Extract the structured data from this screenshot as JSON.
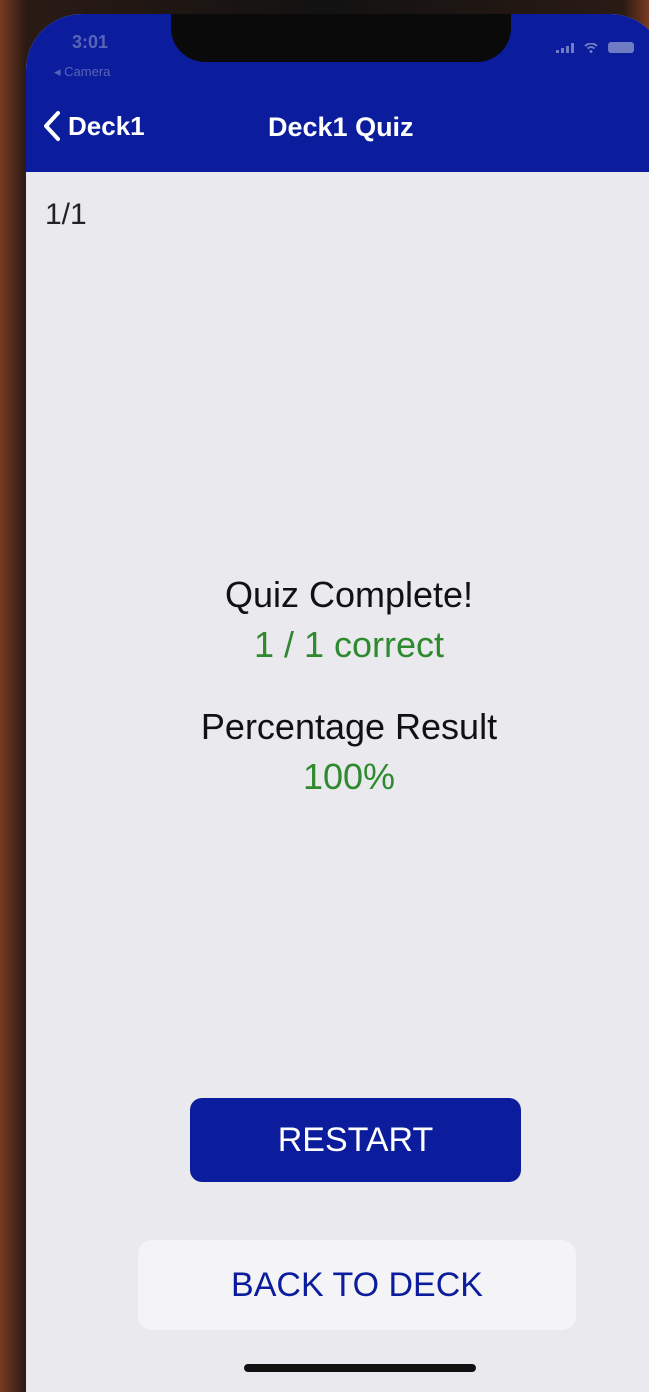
{
  "status_bar": {
    "time": "3:01",
    "back_app": "◂ Camera"
  },
  "nav": {
    "back_label": "Deck1",
    "title": "Deck1 Quiz"
  },
  "quiz": {
    "counter": "1/1",
    "complete_text": "Quiz Complete!",
    "score_text": "1 / 1 correct",
    "percentage_label": "Percentage Result",
    "percentage_value": "100%"
  },
  "actions": {
    "restart_label": "RESTART",
    "back_to_deck_label": "BACK TO DECK"
  },
  "colors": {
    "accent": "#0b1d9c",
    "success": "#2f8a2f",
    "background": "#e9e9ee"
  },
  "icons": {
    "back": "chevron-left-icon",
    "signal": "signal-icon",
    "wifi": "wifi-icon",
    "battery": "battery-icon"
  }
}
